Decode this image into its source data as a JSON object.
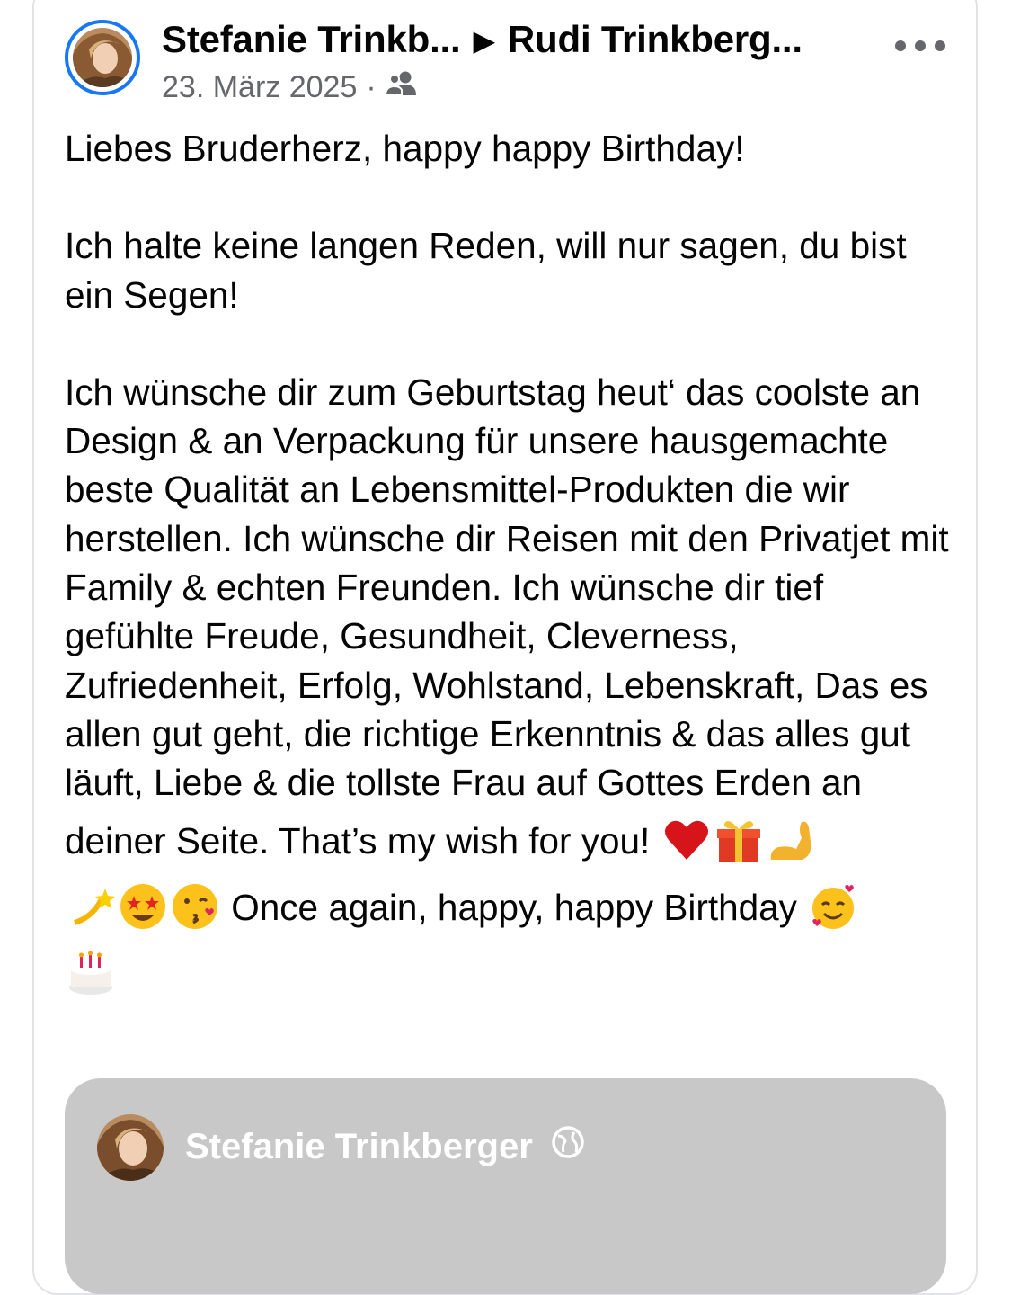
{
  "post": {
    "author": "Stefanie Trinkb...",
    "separator": "▶",
    "recipient": "Rudi Trinkberg...",
    "date": "23. März 2025",
    "dot": "·",
    "audience_icon": "friends-icon",
    "more_icon": "more-options-icon",
    "paragraph1": "Liebes Bruderherz, happy happy Birthday!",
    "paragraph2": "Ich halte keine langen Reden, will nur sagen, du bist ein Segen!",
    "paragraph3": "Ich wünsche dir zum Geburtstag heut‘ das coolste an Design & an Verpackung für unsere hausgemachte beste Qualität an Lebensmittel-Produkten die wir herstellen. Ich wünsche dir Reisen mit den Privatjet mit Family & echten Freunden. Ich wünsche dir tief gefühlte Freude, Gesundheit, Cleverness, Zufriedenheit, Erfolg, Wohlstand, Lebenskraft, Das es allen gut geht, die richtige Erkenntnis & das alles gut läuft, Liebe & die tollste Frau auf Gottes Erden an",
    "line_a": "deiner Seite. That’s my wish for you!",
    "line_b": "Once again, happy, happy Birthday",
    "emojis_a": [
      "heart-emoji",
      "gift-emoji",
      "flexed-biceps-emoji"
    ],
    "emojis_b": [
      "dizzy-emoji",
      "star-struck-emoji",
      "kiss-emoji"
    ],
    "emojis_c": [
      "smiling-hearts-emoji"
    ],
    "emojis_d": [
      "birthday-cake-emoji"
    ]
  },
  "shared": {
    "name": "Stefanie Trinkberger",
    "globe_icon": "globe-icon",
    "background": "#c8c8c8"
  },
  "colors": {
    "accent": "#1877f2",
    "meta": "#65676b",
    "text": "#050505"
  }
}
